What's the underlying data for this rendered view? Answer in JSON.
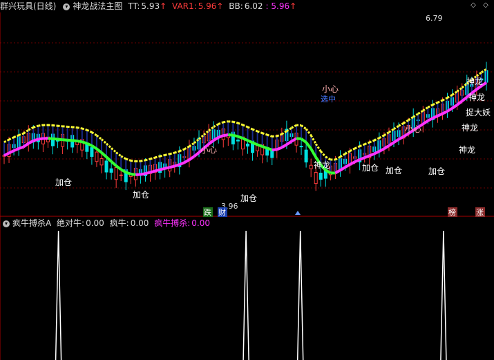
{
  "main_header": {
    "title": "群兴玩具(日线)",
    "indicator_name": "神龙战法主图",
    "tt_label": "TT:",
    "tt_value": "5.93",
    "var1_label": "VAR1:",
    "var1_value": "5.96",
    "bb_label": "BB:",
    "bb_value": "6.02",
    "bb_extra": ": 5.96"
  },
  "sub_header": {
    "indicator_name": "疯牛搏杀A",
    "abs_label": "绝对牛:",
    "abs_value": "0.00",
    "mad_label": "疯牛:",
    "mad_value": "0.00",
    "kill_label": "疯牛搏杀:",
    "kill_value": "0.00"
  },
  "colors": {
    "up": "#ff3b3b",
    "down": "#00e0e0",
    "magenta": "#ff33ff",
    "green": "#33ff33",
    "yellow": "#ffff33",
    "white": "#ffffff"
  },
  "labels": {
    "jiacang": "加仓",
    "shenlong": "神龙",
    "xiaoxin": "小心",
    "xuanzhong": "选中",
    "zhuodayao": "捉大妖",
    "high": "6.79",
    "low": "3.96",
    "die": "跌",
    "cai": "财",
    "bang": "榜",
    "zhang": "涨"
  },
  "chart_data": {
    "type": "line",
    "title": "神龙战法主图",
    "ylim": [
      3.8,
      7.0
    ],
    "n": 100,
    "key_prices": {
      "high": 6.79,
      "low": 3.96,
      "tt": 5.93,
      "var1": 5.96,
      "bb": 6.02
    },
    "spike_positions": [
      11,
      49,
      60,
      89
    ]
  },
  "icons": {
    "panel": "circle-icon",
    "left": "diamond-left-icon",
    "right": "diamond-right-icon"
  }
}
